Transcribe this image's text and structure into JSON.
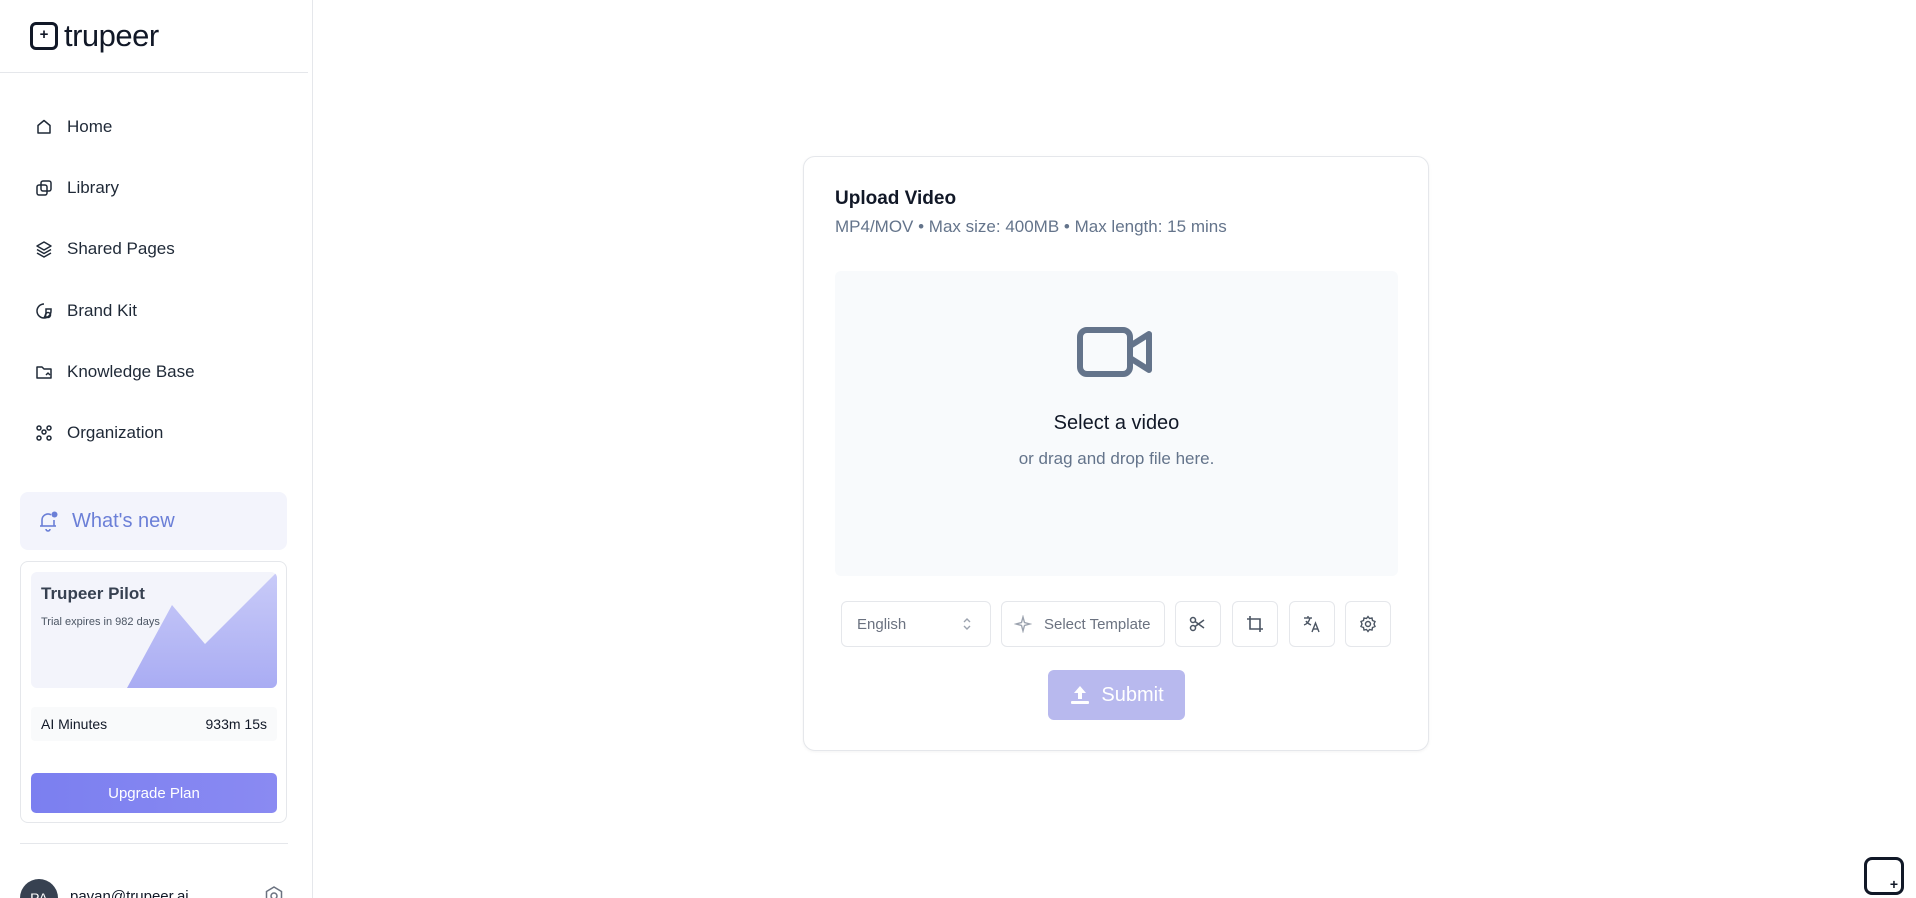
{
  "brand": {
    "name": "trupeer",
    "icon": "trupeer-logo-icon"
  },
  "sidebar": {
    "items": [
      {
        "label": "Home",
        "icon": "home-icon"
      },
      {
        "label": "Library",
        "icon": "library-icon"
      },
      {
        "label": "Shared Pages",
        "icon": "layers-icon"
      },
      {
        "label": "Brand Kit",
        "icon": "brand-kit-icon"
      },
      {
        "label": "Knowledge Base",
        "icon": "folder-icon"
      },
      {
        "label": "Organization",
        "icon": "organization-icon"
      }
    ],
    "whats_new": {
      "label": "What's new",
      "icon": "bell-icon"
    },
    "plan": {
      "title": "Trupeer Pilot",
      "subtitle": "Trial expires in 982 days",
      "ai_minutes_label": "AI Minutes",
      "ai_minutes_value": "933m 15s",
      "upgrade_label": "Upgrade Plan"
    },
    "user": {
      "initials": "PA",
      "email": "pavan@trupeer.ai"
    }
  },
  "upload": {
    "title": "Upload Video",
    "subtitle": "MP4/MOV • Max size: 400MB • Max length: 15 mins",
    "drop_title": "Select a video",
    "drop_subtitle": "or drag and drop file here.",
    "language": "English",
    "template_label": "Select Template",
    "tools": [
      "scissors-icon",
      "crop-icon",
      "translate-icon",
      "settings-icon"
    ],
    "submit_label": "Submit"
  },
  "colors": {
    "accent": "#7b7ff0",
    "whats_new_text": "#6b7fd7",
    "submit_disabled": "#b8b9ee"
  }
}
